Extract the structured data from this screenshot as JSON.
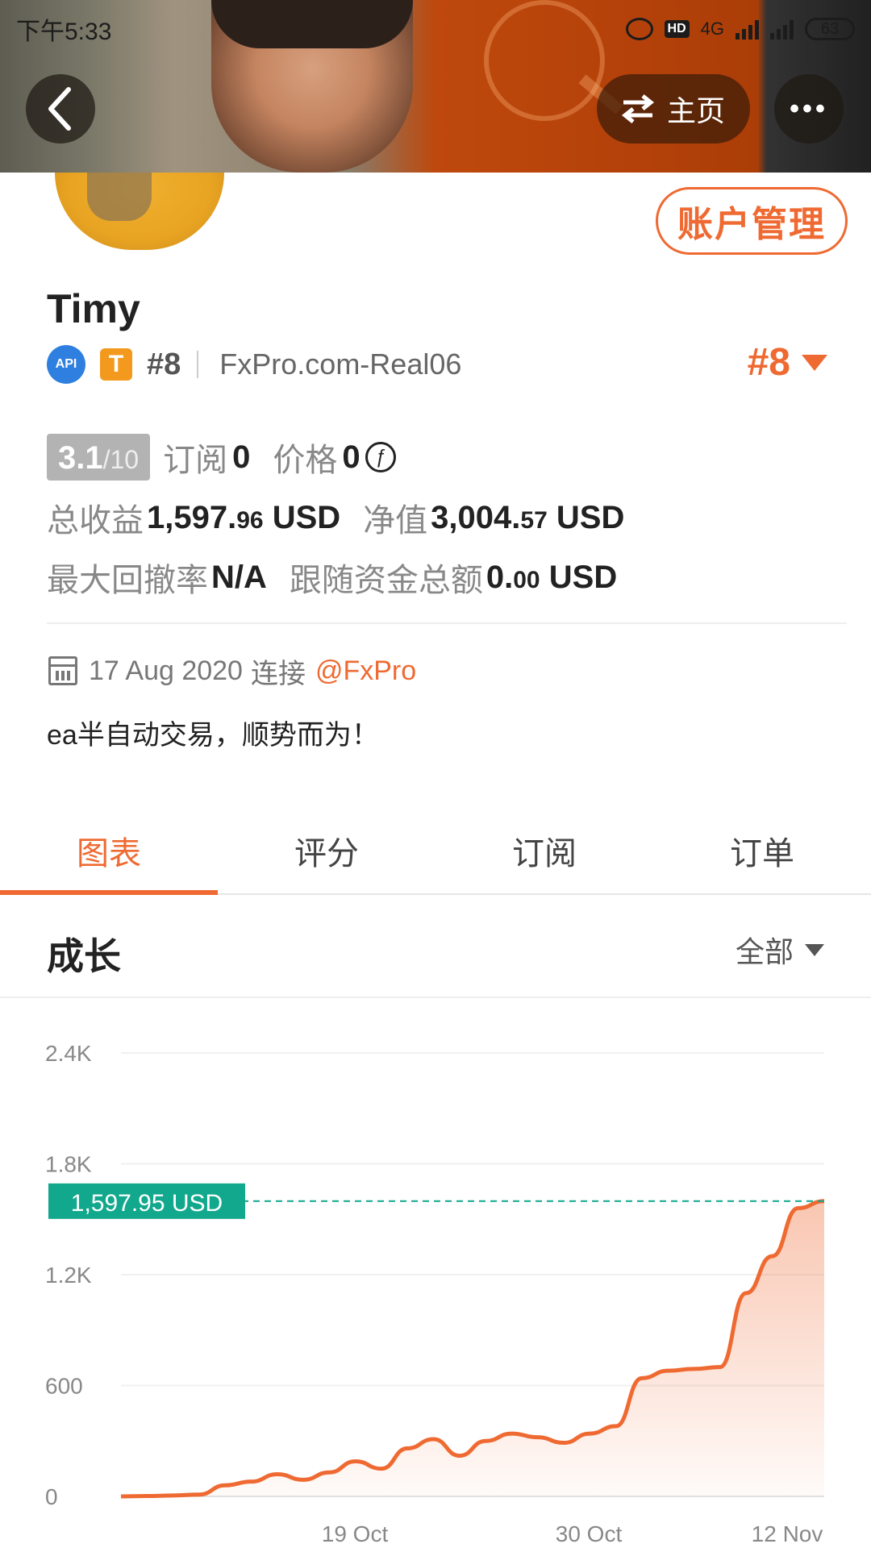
{
  "status_bar": {
    "time": "下午5:33",
    "network": "4G",
    "hd": "HD",
    "battery": "63"
  },
  "header": {
    "home_label": "主页",
    "more_label": "•••"
  },
  "profile": {
    "account_button": "账户管理",
    "name": "Timy",
    "api_badge": "API",
    "tier_badge": "T",
    "rank": "#8",
    "server": "FxPro.com-Real06",
    "rank_big": "#8",
    "score_value": "3.1",
    "score_denominator": "/10",
    "subscribe_label": "订阅",
    "subscribe_value": "0",
    "price_label": "价格",
    "price_value": "0",
    "price_symbol": "ƒ",
    "total_profit_label": "总收益",
    "total_profit_int": "1,597.",
    "total_profit_dec": "96",
    "total_profit_unit": "USD",
    "equity_label": "净值",
    "equity_int": "3,004.",
    "equity_dec": "57",
    "equity_unit": "USD",
    "max_drawdown_label": "最大回撤率",
    "max_drawdown_value": "N/A",
    "follow_funds_label": "跟随资金总额",
    "follow_funds_int": "0.",
    "follow_funds_dec": "00",
    "follow_funds_unit": "USD",
    "connect_date": "17 Aug 2020",
    "connect_label": "连接",
    "connect_via": "@FxPro",
    "bio": "ea半自动交易，顺势而为！"
  },
  "tabs": [
    {
      "label": "图表",
      "active": true
    },
    {
      "label": "评分",
      "active": false
    },
    {
      "label": "订阅",
      "active": false
    },
    {
      "label": "订单",
      "active": false
    }
  ],
  "section": {
    "title": "成长",
    "range": "全部"
  },
  "colors": {
    "accent": "#ef6a32",
    "teal": "#12a88d",
    "line": "#ef6a32"
  },
  "chart_data": {
    "type": "area",
    "y_ticks": [
      "2.4K",
      "1.8K",
      "1.2K",
      "600",
      "0"
    ],
    "x_ticks": [
      "19 Oct",
      "30 Oct",
      "12 Nov"
    ],
    "ylim": [
      0,
      2400
    ],
    "current_value": 1597.95,
    "current_label": "1,597.95 USD",
    "values": [
      0,
      2,
      5,
      10,
      60,
      80,
      120,
      90,
      130,
      190,
      150,
      260,
      310,
      220,
      300,
      340,
      320,
      290,
      340,
      380,
      640,
      680,
      690,
      700,
      1100,
      1300,
      1560,
      1597.95
    ]
  }
}
